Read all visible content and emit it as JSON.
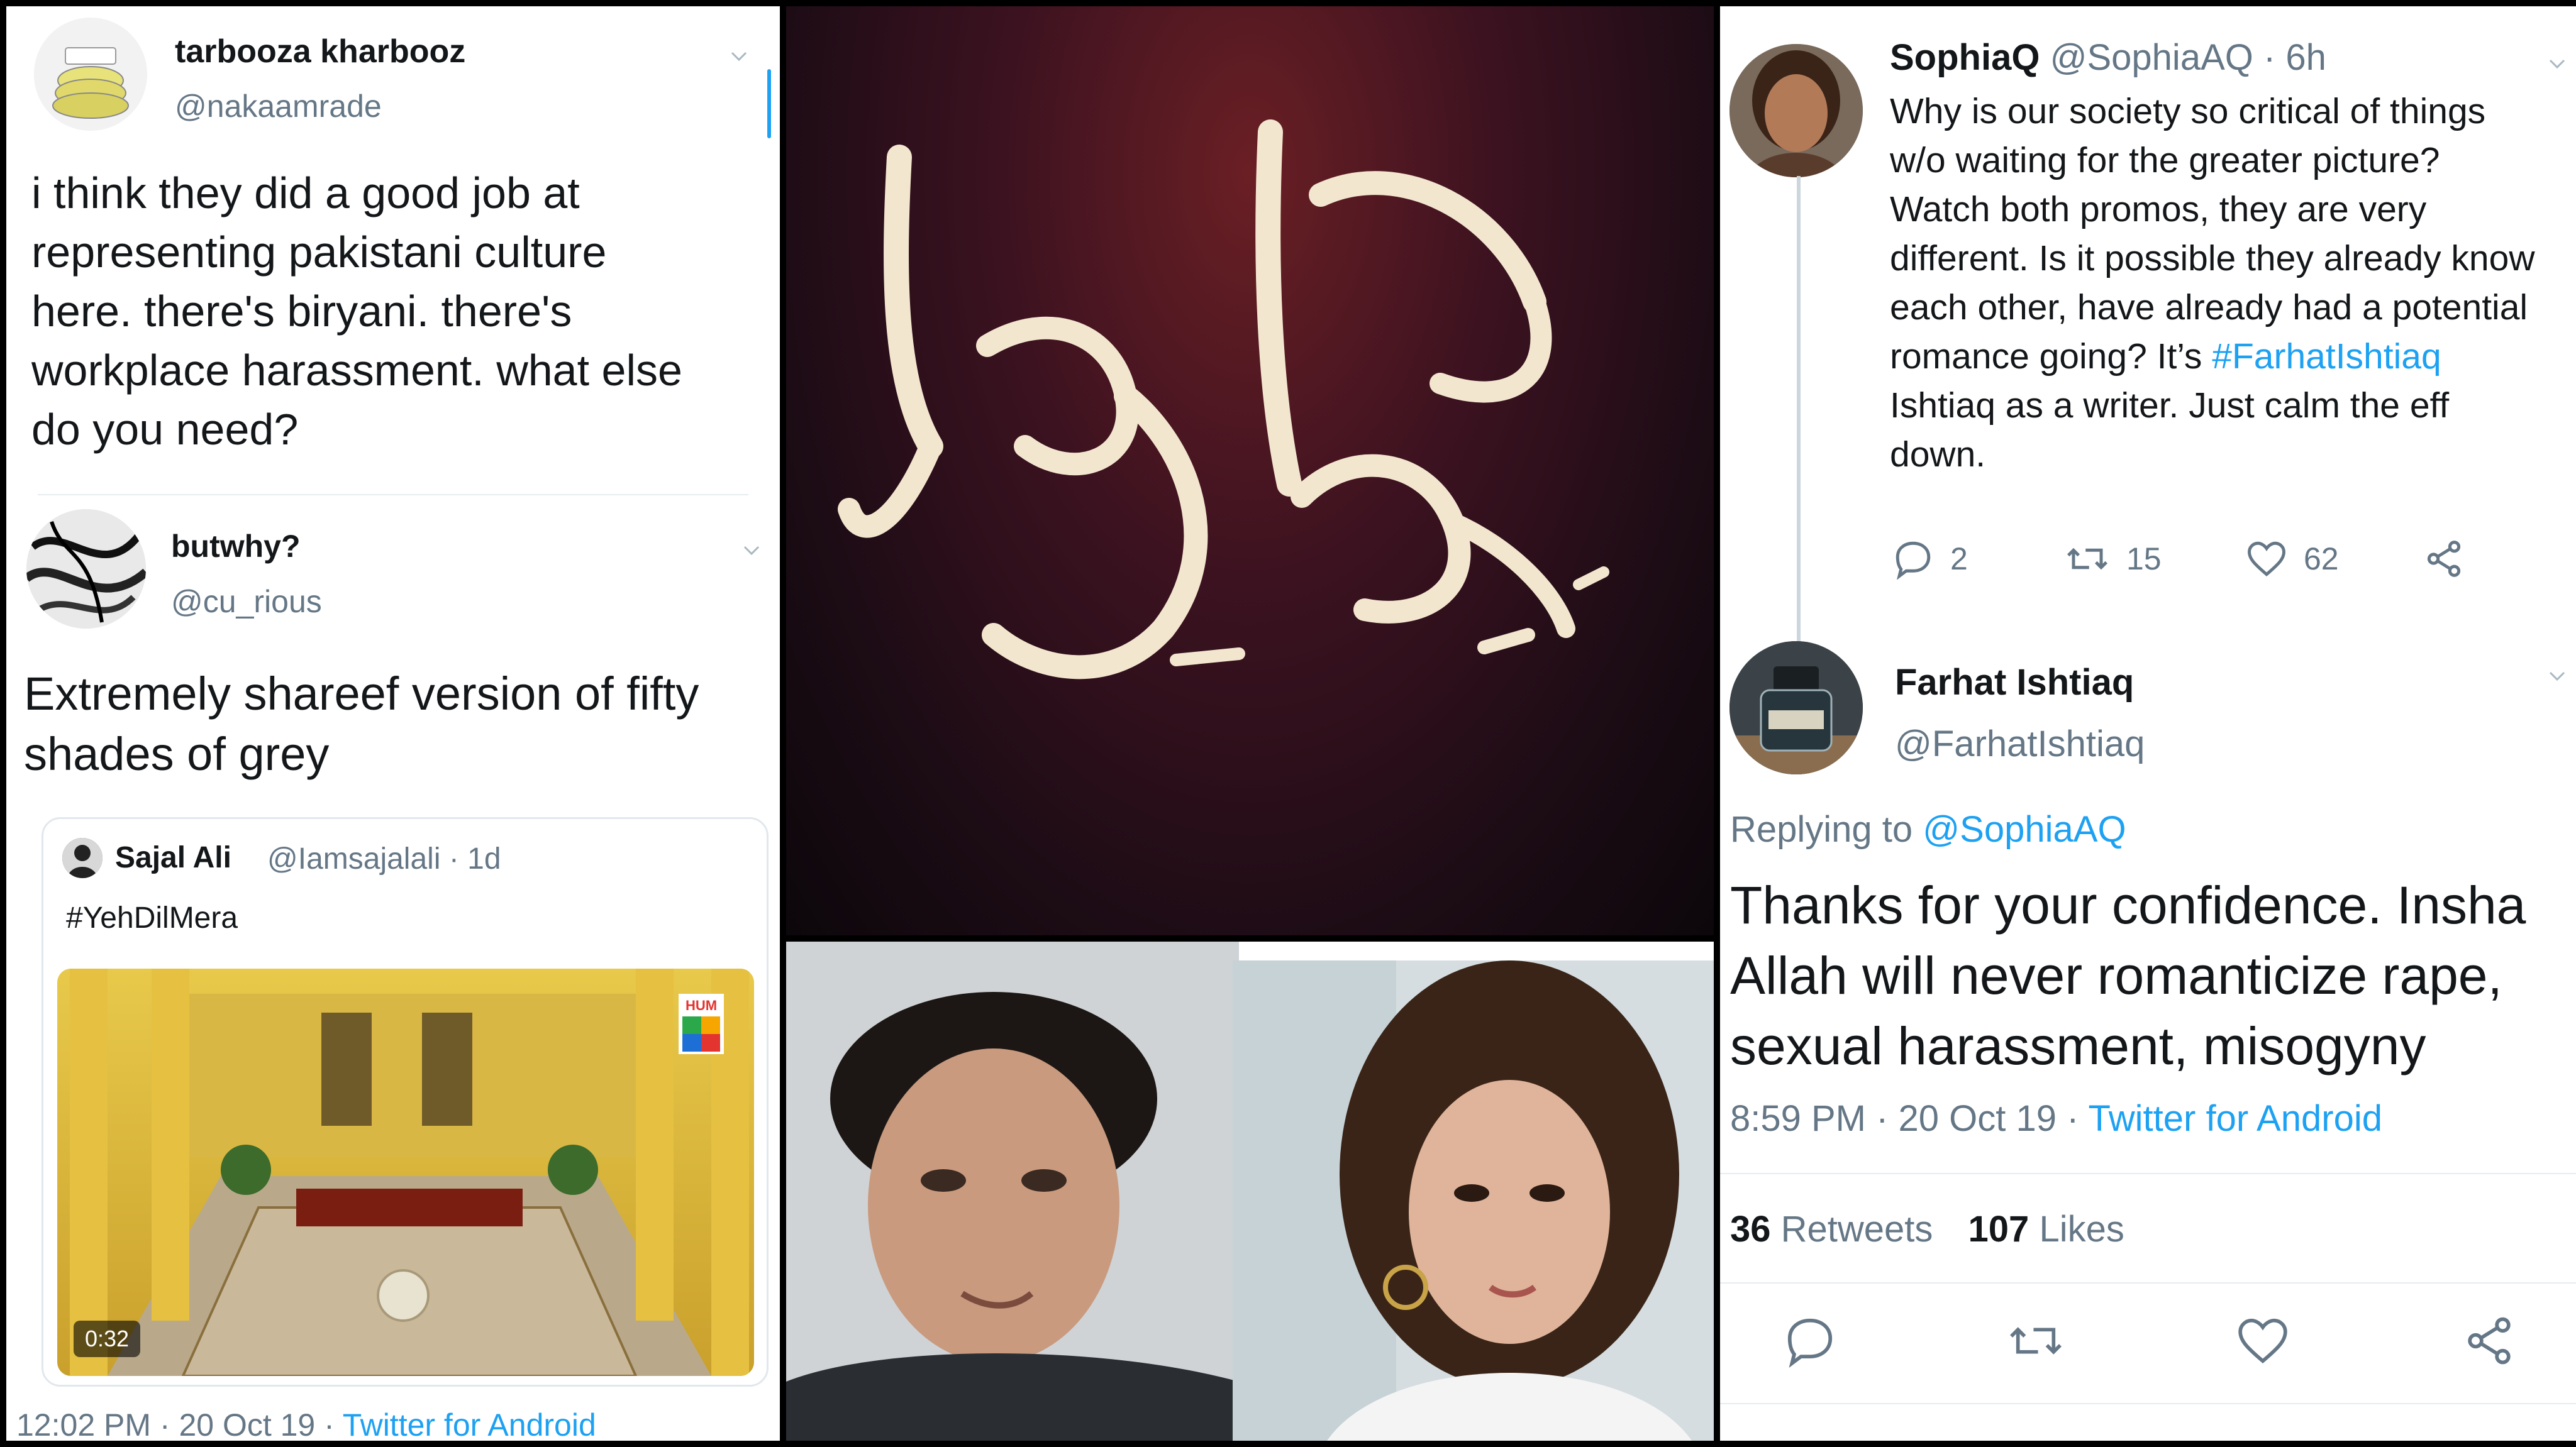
{
  "left": {
    "tweet1": {
      "name": "tarbooza kharbooz",
      "handle": "@nakaamrade",
      "text_lines": [
        "i think they did a good job at",
        "representing pakistani culture",
        "here. there's biryani. there's",
        "workplace harassment. what else",
        "do you need?"
      ]
    },
    "tweet2": {
      "name": "butwhy?",
      "handle": "@cu_rious",
      "text_lines": [
        "Extremely shareef version of fifty",
        "shades of grey"
      ],
      "quote": {
        "name": "Sajal Ali",
        "handle": "@Iamsajalali",
        "time": "· 1d",
        "text": "#YehDilMera",
        "video_duration": "0:32",
        "channel_logo_text": "HUM"
      },
      "footer_time": "12:02 PM · 20 Oct 19 ·",
      "footer_source": "Twitter for Android"
    }
  },
  "right": {
    "tweet1": {
      "name": "SophiaQ",
      "handle": "@SophiaAQ",
      "time": "· 6h",
      "text_lines": [
        "Why is our society so critical of things",
        "w/o waiting for the greater picture?",
        "Watch both promos, they are very",
        "different. Is it possible they already know",
        "each other, have  already had a potential"
      ],
      "text_line6_before": "romance going? It’s",
      "text_line6_hashtag": "#FarhatIshtiaq",
      "text_lines_after": [
        "Ishtiaq as a writer. Just calm the eff",
        "down."
      ],
      "replies": "2",
      "retweets": "15",
      "likes": "62"
    },
    "tweet2": {
      "name": "Farhat Ishtiaq",
      "handle": "@FarhatIshtiaq",
      "replying_prefix": "Replying to",
      "replying_handle": "@SophiaAQ",
      "text_lines": [
        "Thanks for your confidence. Insha",
        "Allah will never romanticize rape,",
        "sexual harassment, misogyny"
      ],
      "meta_time": "8:59 PM · 20 Oct 19 ·",
      "meta_source": "Twitter for Android",
      "retweets_count": "36",
      "retweets_label": "Retweets",
      "likes_count": "107",
      "likes_label": "Likes"
    }
  },
  "colors": {
    "link": "#1da1f2",
    "secondary_text": "#657786",
    "primary_text": "#14171a",
    "divider": "#e6ecf0",
    "title_card_red": "#6a1f24"
  }
}
